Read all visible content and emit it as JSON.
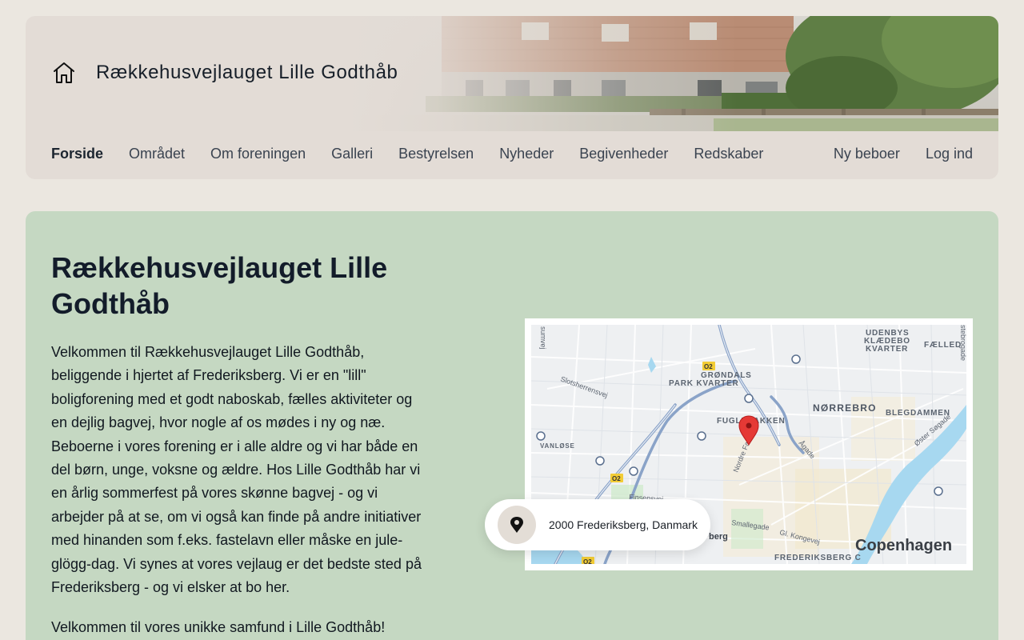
{
  "site": {
    "title": "Rækkehusvejlauget Lille Godthåb"
  },
  "nav": {
    "items": [
      {
        "label": "Forside"
      },
      {
        "label": "Området"
      },
      {
        "label": "Om foreningen"
      },
      {
        "label": "Galleri"
      },
      {
        "label": "Bestyrelsen"
      },
      {
        "label": "Nyheder"
      },
      {
        "label": "Begivenheder"
      },
      {
        "label": "Redskaber"
      }
    ],
    "right": [
      {
        "label": "Ny beboer"
      },
      {
        "label": "Log ind"
      }
    ]
  },
  "main": {
    "title": "Rækkehusvejlauget Lille Godthåb",
    "intro": "Velkommen til Rækkehusvejlauget Lille Godthåb, beliggende i hjertet af Frederiksberg. Vi er en \"lill\" boligforening med et godt naboskab, fælles aktiviteter og en dejlig bagvej, hvor nogle af os mødes i ny og næ. Beboerne i vores forening er i alle aldre og vi har både en del børn, unge, voksne og ældre. Hos Lille Godthåb har vi en årlig sommerfest på vores skønne bagvej - og vi arbejder på at se, om vi også kan finde på andre initiativer med hinanden som f.eks. fastelavn eller måske en jule-glögg-dag. Vi synes at vores vejlaug er det bedste sted på Frederiksberg - og vi elsker at bo her.",
    "welcome": "Velkommen til vores unikke samfund i Lille Godthåb!"
  },
  "address": {
    "text": "2000 Frederiksberg, Danmark",
    "icon": "map-pin-icon"
  },
  "map": {
    "labels": {
      "udenbys1": "UDENBYS",
      "udenbys2": "KLÆDEBO",
      "udenbys3": "KVARTER",
      "faelled": "FÆLLED",
      "grondals1": "GRØNDALS",
      "grondals2": "PARK KVARTER",
      "norrebro": "NØRREBRO",
      "blegdammen": "BLEGDAMMEN",
      "fuglebakken": "FUGLEBAKKEN",
      "vanlose": "VANLØSE",
      "slotsherrensvej": "Slotsherrensvej",
      "nordre_fasanvej": "Nordre Fasanvej",
      "aagade": "Ågade",
      "oster_sogade": "Øster Søgade",
      "finsensvej": "Finsensvej",
      "smallegade": "Smallegade",
      "gl_kongevej": "Gl. Kongevej",
      "frederiksberg_c": "FREDERIKSBERG C",
      "copenhagen": "Copenhagen",
      "berg": "berg",
      "sumvej": "sumvej",
      "stebrogade": "stebrogade",
      "o2a": "O2",
      "o2b": "O2",
      "o2c": "O2"
    }
  },
  "colors": {
    "page_bg": "#ebe7e0",
    "header_bg": "#e3dcd6",
    "main_bg": "#c5d8c2",
    "map_water": "#a7d8f0",
    "map_road_major": "#8aa3c8",
    "map_pin": "#e53935"
  }
}
